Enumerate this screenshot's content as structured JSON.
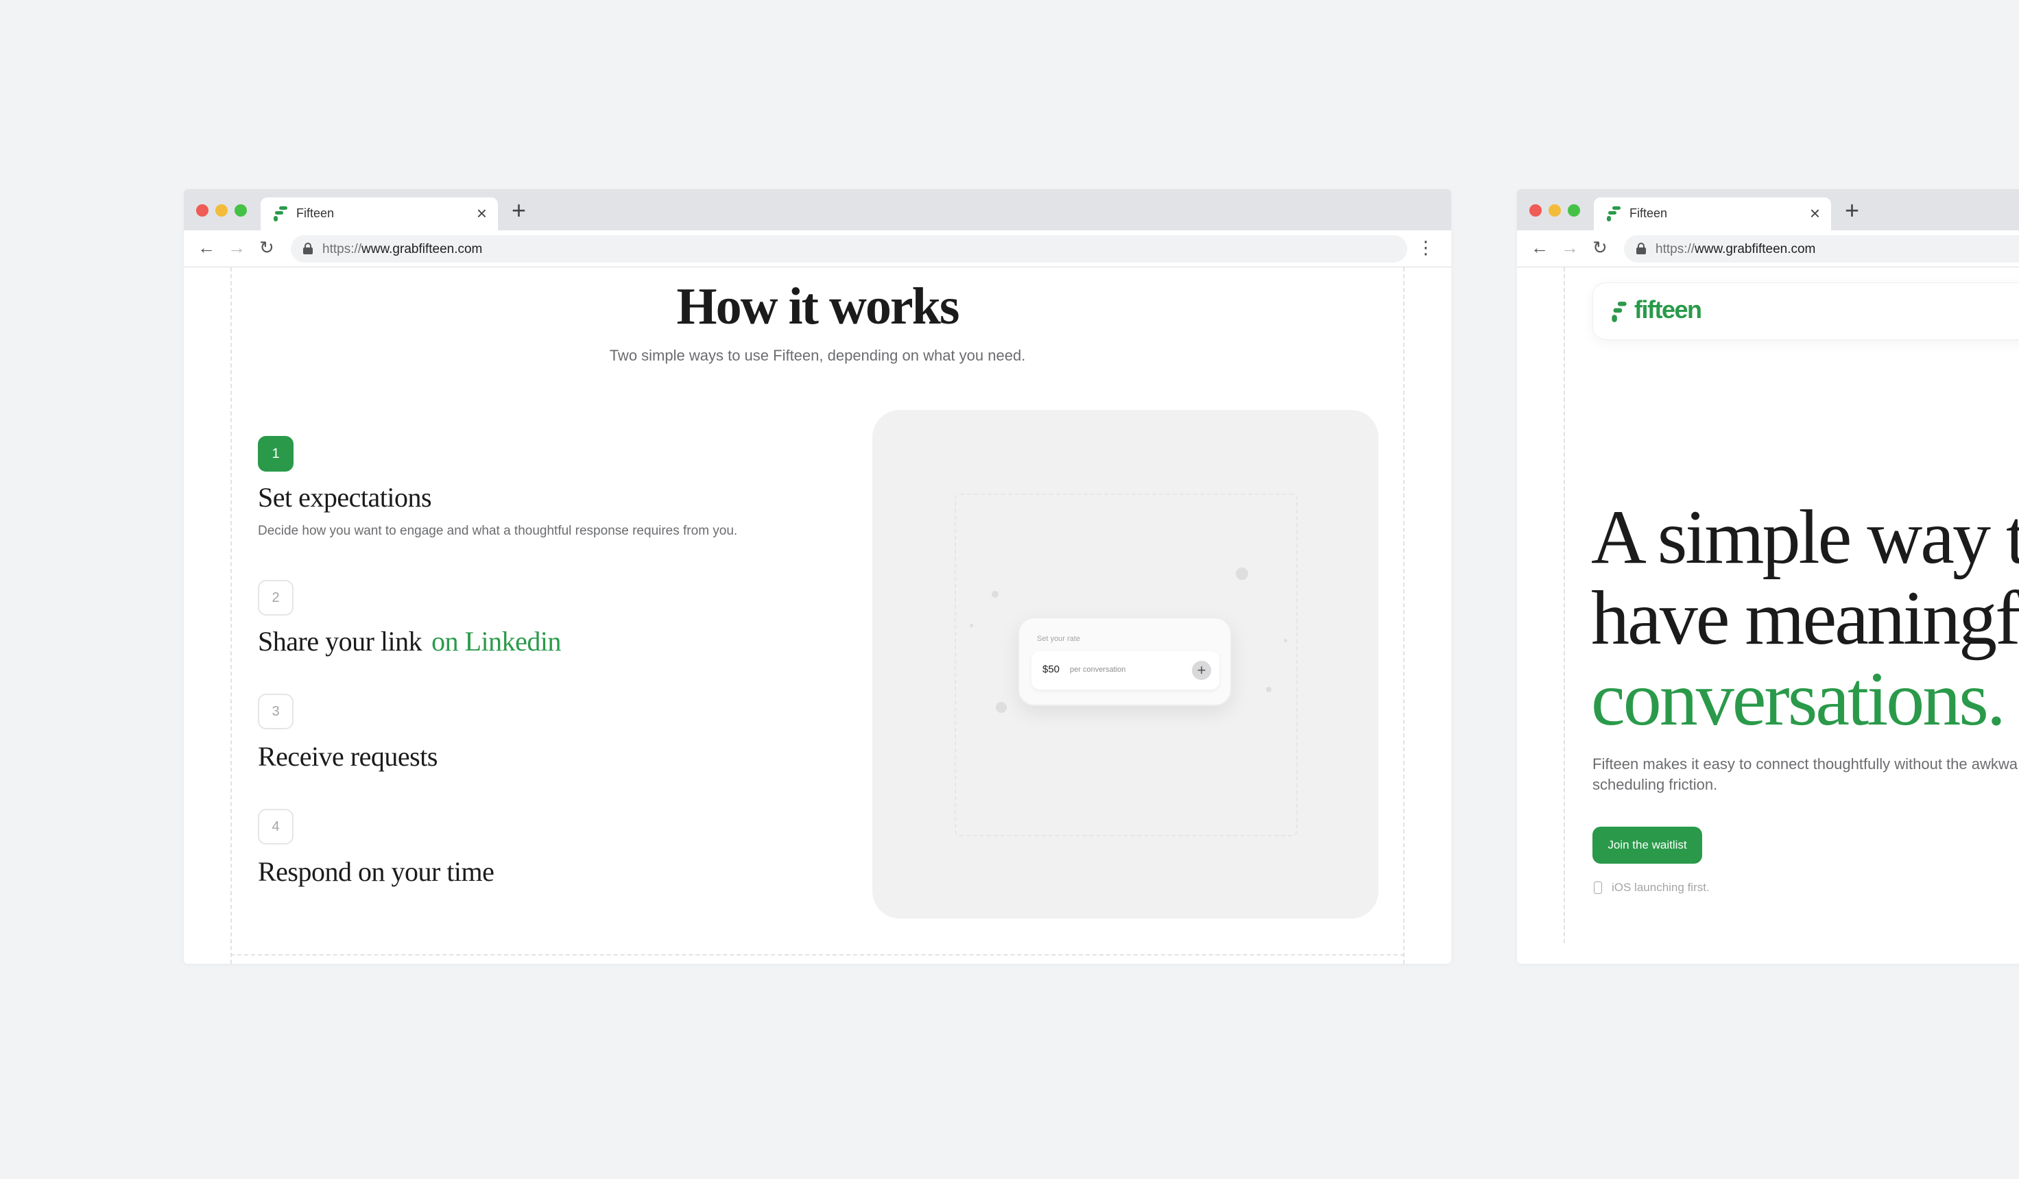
{
  "browser": {
    "tab_title": "Fifteen",
    "tab_close": "×",
    "new_tab": "+",
    "url_protocol": "https://",
    "url_host": "www.grabfifteen.com"
  },
  "colors": {
    "brand_green": "#2a9a4a"
  },
  "how_it_works": {
    "title": "How it works",
    "subtitle": "Two simple ways to use Fifteen, depending on what you need.",
    "steps": [
      {
        "number": "1",
        "title": "Set expectations",
        "description": "Decide how you want to engage and what a thoughtful response requires from you."
      },
      {
        "number": "2",
        "title": "Share your link",
        "accent": "on Linkedin"
      },
      {
        "number": "3",
        "title": "Receive requests"
      },
      {
        "number": "4",
        "title": "Respond on your time"
      }
    ],
    "illustration": {
      "label": "Set your rate",
      "amount": "$50",
      "unit": "per conversation",
      "plus": "+"
    }
  },
  "landing": {
    "brand": "fifteen",
    "hero_line1": "A simple way t",
    "hero_line2": "have meaningf",
    "hero_line3": "conversations.",
    "subtitle": "Fifteen makes it easy to connect thoughtfully without the awkwa scheduling friction.",
    "cta": "Join the waitlist",
    "note": "iOS launching first."
  }
}
